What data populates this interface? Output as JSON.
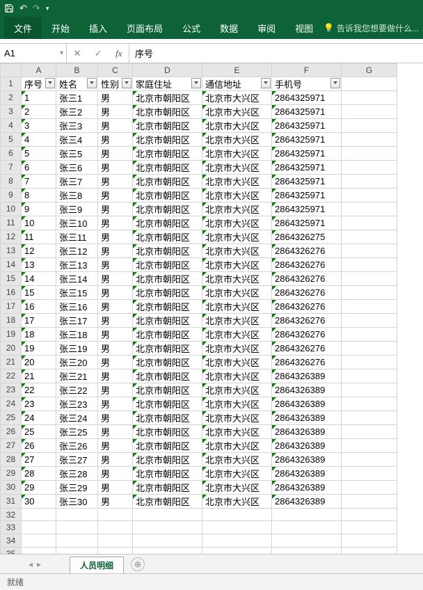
{
  "qat": {
    "save": "💾",
    "undo": "↶",
    "redo": "↷"
  },
  "ribbon": {
    "file": "文件",
    "tabs": [
      "开始",
      "插入",
      "页面布局",
      "公式",
      "数据",
      "审阅",
      "视图"
    ],
    "tell_me": "告诉我您想要做什么..."
  },
  "namebox": "A1",
  "formula_bar_value": "序号",
  "columns": [
    "A",
    "B",
    "C",
    "D",
    "E",
    "F",
    "G"
  ],
  "col_widths": [
    "cA",
    "cB",
    "cC",
    "cD",
    "cE",
    "cF",
    "cG"
  ],
  "headers": [
    "序号",
    "姓名",
    "性别",
    "家庭住址",
    "通信地址",
    "手机号"
  ],
  "rows": [
    {
      "n": "1",
      "name": "张三1",
      "sex": "男",
      "addr1": "北京市朝阳区",
      "addr2": "北京市大兴区",
      "phone": "2864325971"
    },
    {
      "n": "2",
      "name": "张三2",
      "sex": "男",
      "addr1": "北京市朝阳区",
      "addr2": "北京市大兴区",
      "phone": "2864325971"
    },
    {
      "n": "3",
      "name": "张三3",
      "sex": "男",
      "addr1": "北京市朝阳区",
      "addr2": "北京市大兴区",
      "phone": "2864325971"
    },
    {
      "n": "4",
      "name": "张三4",
      "sex": "男",
      "addr1": "北京市朝阳区",
      "addr2": "北京市大兴区",
      "phone": "2864325971"
    },
    {
      "n": "5",
      "name": "张三5",
      "sex": "男",
      "addr1": "北京市朝阳区",
      "addr2": "北京市大兴区",
      "phone": "2864325971"
    },
    {
      "n": "6",
      "name": "张三6",
      "sex": "男",
      "addr1": "北京市朝阳区",
      "addr2": "北京市大兴区",
      "phone": "2864325971"
    },
    {
      "n": "7",
      "name": "张三7",
      "sex": "男",
      "addr1": "北京市朝阳区",
      "addr2": "北京市大兴区",
      "phone": "2864325971"
    },
    {
      "n": "8",
      "name": "张三8",
      "sex": "男",
      "addr1": "北京市朝阳区",
      "addr2": "北京市大兴区",
      "phone": "2864325971"
    },
    {
      "n": "9",
      "name": "张三9",
      "sex": "男",
      "addr1": "北京市朝阳区",
      "addr2": "北京市大兴区",
      "phone": "2864325971"
    },
    {
      "n": "10",
      "name": "张三10",
      "sex": "男",
      "addr1": "北京市朝阳区",
      "addr2": "北京市大兴区",
      "phone": "2864325971"
    },
    {
      "n": "11",
      "name": "张三11",
      "sex": "男",
      "addr1": "北京市朝阳区",
      "addr2": "北京市大兴区",
      "phone": "2864326275"
    },
    {
      "n": "12",
      "name": "张三12",
      "sex": "男",
      "addr1": "北京市朝阳区",
      "addr2": "北京市大兴区",
      "phone": "2864326276"
    },
    {
      "n": "13",
      "name": "张三13",
      "sex": "男",
      "addr1": "北京市朝阳区",
      "addr2": "北京市大兴区",
      "phone": "2864326276"
    },
    {
      "n": "14",
      "name": "张三14",
      "sex": "男",
      "addr1": "北京市朝阳区",
      "addr2": "北京市大兴区",
      "phone": "2864326276"
    },
    {
      "n": "15",
      "name": "张三15",
      "sex": "男",
      "addr1": "北京市朝阳区",
      "addr2": "北京市大兴区",
      "phone": "2864326276"
    },
    {
      "n": "16",
      "name": "张三16",
      "sex": "男",
      "addr1": "北京市朝阳区",
      "addr2": "北京市大兴区",
      "phone": "2864326276"
    },
    {
      "n": "17",
      "name": "张三17",
      "sex": "男",
      "addr1": "北京市朝阳区",
      "addr2": "北京市大兴区",
      "phone": "2864326276"
    },
    {
      "n": "18",
      "name": "张三18",
      "sex": "男",
      "addr1": "北京市朝阳区",
      "addr2": "北京市大兴区",
      "phone": "2864326276"
    },
    {
      "n": "19",
      "name": "张三19",
      "sex": "男",
      "addr1": "北京市朝阳区",
      "addr2": "北京市大兴区",
      "phone": "2864326276"
    },
    {
      "n": "20",
      "name": "张三20",
      "sex": "男",
      "addr1": "北京市朝阳区",
      "addr2": "北京市大兴区",
      "phone": "2864326276"
    },
    {
      "n": "21",
      "name": "张三21",
      "sex": "男",
      "addr1": "北京市朝阳区",
      "addr2": "北京市大兴区",
      "phone": "2864326389"
    },
    {
      "n": "22",
      "name": "张三22",
      "sex": "男",
      "addr1": "北京市朝阳区",
      "addr2": "北京市大兴区",
      "phone": "2864326389"
    },
    {
      "n": "23",
      "name": "张三23",
      "sex": "男",
      "addr1": "北京市朝阳区",
      "addr2": "北京市大兴区",
      "phone": "2864326389"
    },
    {
      "n": "24",
      "name": "张三24",
      "sex": "男",
      "addr1": "北京市朝阳区",
      "addr2": "北京市大兴区",
      "phone": "2864326389"
    },
    {
      "n": "25",
      "name": "张三25",
      "sex": "男",
      "addr1": "北京市朝阳区",
      "addr2": "北京市大兴区",
      "phone": "2864326389"
    },
    {
      "n": "26",
      "name": "张三26",
      "sex": "男",
      "addr1": "北京市朝阳区",
      "addr2": "北京市大兴区",
      "phone": "2864326389"
    },
    {
      "n": "27",
      "name": "张三27",
      "sex": "男",
      "addr1": "北京市朝阳区",
      "addr2": "北京市大兴区",
      "phone": "2864326389"
    },
    {
      "n": "28",
      "name": "张三28",
      "sex": "男",
      "addr1": "北京市朝阳区",
      "addr2": "北京市大兴区",
      "phone": "2864326389"
    },
    {
      "n": "29",
      "name": "张三29",
      "sex": "男",
      "addr1": "北京市朝阳区",
      "addr2": "北京市大兴区",
      "phone": "2864326389"
    },
    {
      "n": "30",
      "name": "张三30",
      "sex": "男",
      "addr1": "北京市朝阳区",
      "addr2": "北京市大兴区",
      "phone": "2864326389"
    }
  ],
  "empty_rows": [
    32,
    33,
    34,
    35
  ],
  "sheet_tab": "人员明细",
  "status_text": "就绪",
  "new_sheet_glyph": "⊕"
}
